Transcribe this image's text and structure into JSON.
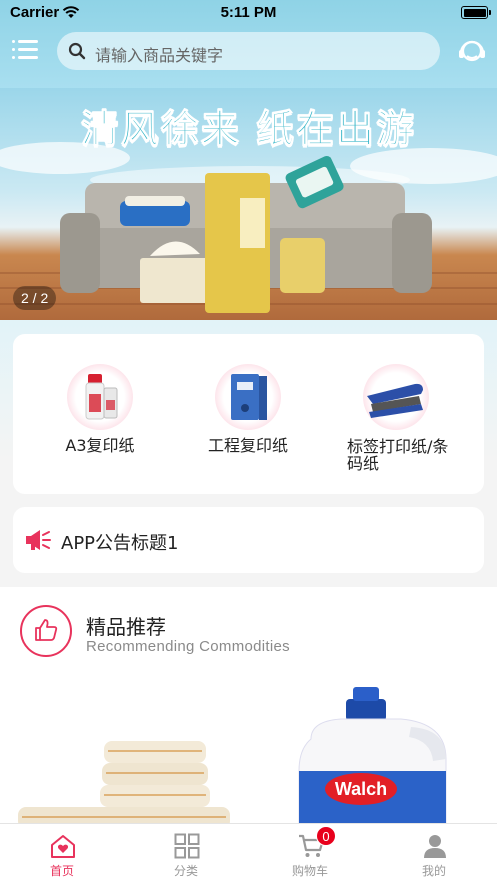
{
  "status_bar": {
    "carrier": "Carrier",
    "time": "5:11 PM"
  },
  "search": {
    "placeholder": "请输入商品关键字"
  },
  "banner": {
    "headline": "清风徐来 纸在出游",
    "counter": "2 / 2"
  },
  "categories": [
    {
      "label": "A3复印纸",
      "icon": "ink-bottle-icon"
    },
    {
      "label": "工程复印纸",
      "icon": "file-box-icon"
    },
    {
      "label": "标签打印纸/条码纸",
      "icon": "stapler-icon"
    }
  ],
  "notice": {
    "text": "APP公告标题1",
    "icon": "megaphone-icon"
  },
  "recommend": {
    "title": "精品推荐",
    "subtitle": "Recommending Commodities",
    "icon": "thumbs-up-icon"
  },
  "products": [
    {
      "image": "towel-stack-image"
    },
    {
      "image": "walch-detergent-image"
    }
  ],
  "tabbar": {
    "items": [
      {
        "label": "首页",
        "icon": "home-heart-icon",
        "active": true
      },
      {
        "label": "分类",
        "icon": "grid-icon",
        "active": false
      },
      {
        "label": "购物车",
        "icon": "cart-icon",
        "active": false
      },
      {
        "label": "我的",
        "icon": "user-icon",
        "active": false
      }
    ],
    "cart_count": "0"
  },
  "colors": {
    "accent": "#e8335c",
    "badge": "#e8001c",
    "banner_title": "#2fb3c6"
  }
}
